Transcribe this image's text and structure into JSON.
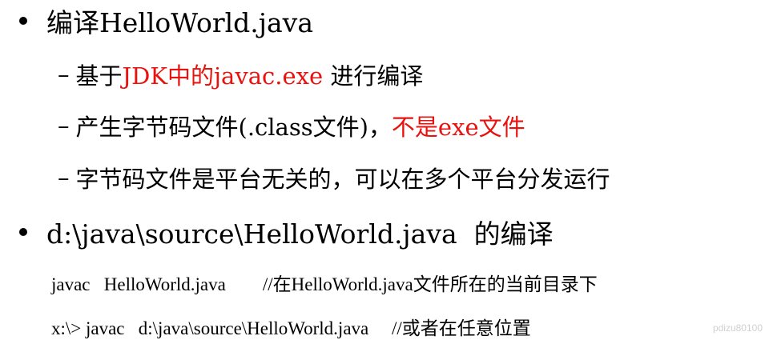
{
  "bullets": [
    {
      "text": "编译HelloWorld.java"
    },
    {
      "text": "d:\\java\\source\\HelloWorld.java  的编译"
    }
  ],
  "subitems": {
    "item1": {
      "dash": "–",
      "prefix": "基于",
      "highlight": "JDK中的javac.exe",
      "suffix": " 进行编译"
    },
    "item2": {
      "dash": "–",
      "prefix": "产生字节码文件(.class文件)，",
      "highlight": "不是exe文件"
    },
    "item3": {
      "dash": "–",
      "text": "字节码文件是平台无关的，可以在多个平台分发运行"
    }
  },
  "code_lines": [
    {
      "command": "javac   HelloWorld.java",
      "comment": "//在HelloWorld.java文件所在的当前目录下"
    },
    {
      "command": "x:\\> javac   d:\\java\\source\\HelloWorld.java",
      "comment": "//或者在任意位置"
    }
  ],
  "watermark": "pdizu80100",
  "colors": {
    "highlight": "#e8120e",
    "text": "#000000"
  }
}
